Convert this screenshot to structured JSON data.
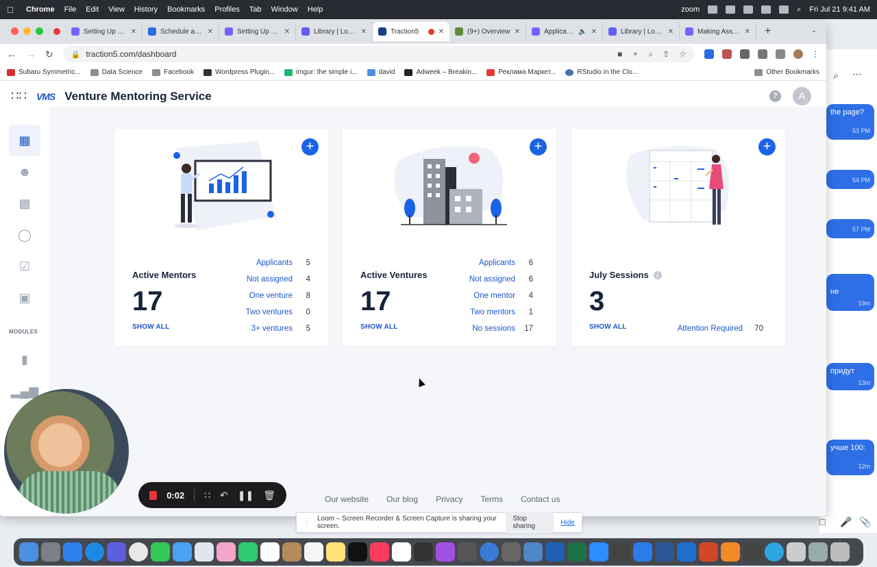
{
  "menubar": {
    "app": "Chrome",
    "items": [
      "File",
      "Edit",
      "View",
      "History",
      "Bookmarks",
      "Profiles",
      "Tab",
      "Window",
      "Help"
    ],
    "zoom": "zoom",
    "datetime": "Fri Jul 21  9:41 AM"
  },
  "tabs": [
    {
      "label": "Setting Up Your",
      "color": "#7b61ff"
    },
    {
      "label": "Schedule a Mee",
      "color": "#2d6be4"
    },
    {
      "label": "Setting Up Your",
      "color": "#7b61ff"
    },
    {
      "label": "Library | Loom",
      "color": "#625df5"
    },
    {
      "label": "Traction5",
      "color": "#1a3f8f",
      "active": true
    },
    {
      "label": "(9+) Overview",
      "color": "#5a8a3a"
    },
    {
      "label": "Application",
      "color": "#7b61ff"
    },
    {
      "label": "Library | Loom",
      "color": "#625df5"
    },
    {
      "label": "Making Assignm",
      "color": "#7b61ff"
    }
  ],
  "address": {
    "url": "traction5.com/dashboard"
  },
  "bookmarks": [
    "Subaru Symmetric...",
    "Data Science",
    "Facebook",
    "Wordpress Plugin...",
    "imgur: the simple i...",
    "david",
    "Adweek – Breakin...",
    "Реклама Маркет...",
    "RStudio in the Clo..."
  ],
  "bookmarks_other": "Other Bookmarks",
  "app": {
    "logo": "VMS",
    "title": "Venture Mentoring Service",
    "help": "?",
    "avatar": "A"
  },
  "sidebar": {
    "section": "MODULES"
  },
  "cards": [
    {
      "title": "Active Mentors",
      "count": "17",
      "show_all": "SHOW ALL",
      "stats": [
        {
          "label": "Applicants",
          "value": "5"
        },
        {
          "label": "Not assigned",
          "value": "4"
        },
        {
          "label": "One venture",
          "value": "8"
        },
        {
          "label": "Two ventures",
          "value": "0"
        },
        {
          "label": "3+ ventures",
          "value": "5"
        }
      ]
    },
    {
      "title": "Active Ventures",
      "count": "17",
      "show_all": "SHOW ALL",
      "stats": [
        {
          "label": "Applicants",
          "value": "6"
        },
        {
          "label": "Not assigned",
          "value": "6"
        },
        {
          "label": "One mentor",
          "value": "4"
        },
        {
          "label": "Two mentors",
          "value": "1"
        },
        {
          "label": "No sessions",
          "value": "17"
        }
      ]
    },
    {
      "title": "July Sessions",
      "count": "3",
      "show_all": "SHOW ALL",
      "stats": [
        {
          "label": "Attention Required",
          "value": "70"
        }
      ]
    }
  ],
  "footer": [
    "Our website",
    "Our blog",
    "Privacy",
    "Terms",
    "Contact us"
  ],
  "recorder": {
    "time": "0:02"
  },
  "loom_banner": {
    "text": "Loom – Screen Recorder & Screen Capture is sharing your screen.",
    "stop": "Stop sharing",
    "hide": "Hide"
  },
  "chat": [
    {
      "text": "the page?",
      "time": "53 PM"
    },
    {
      "text": "",
      "time": "54 PM"
    },
    {
      "text": "",
      "time": "57 PM"
    },
    {
      "text": "не",
      "time": "19m"
    },
    {
      "text": "придут",
      "time": "13m"
    },
    {
      "text": "учше 100:",
      "time": "12m"
    }
  ],
  "colors": {
    "accent": "#1a63e6",
    "link": "#1a56c9",
    "title": "#16233a"
  }
}
